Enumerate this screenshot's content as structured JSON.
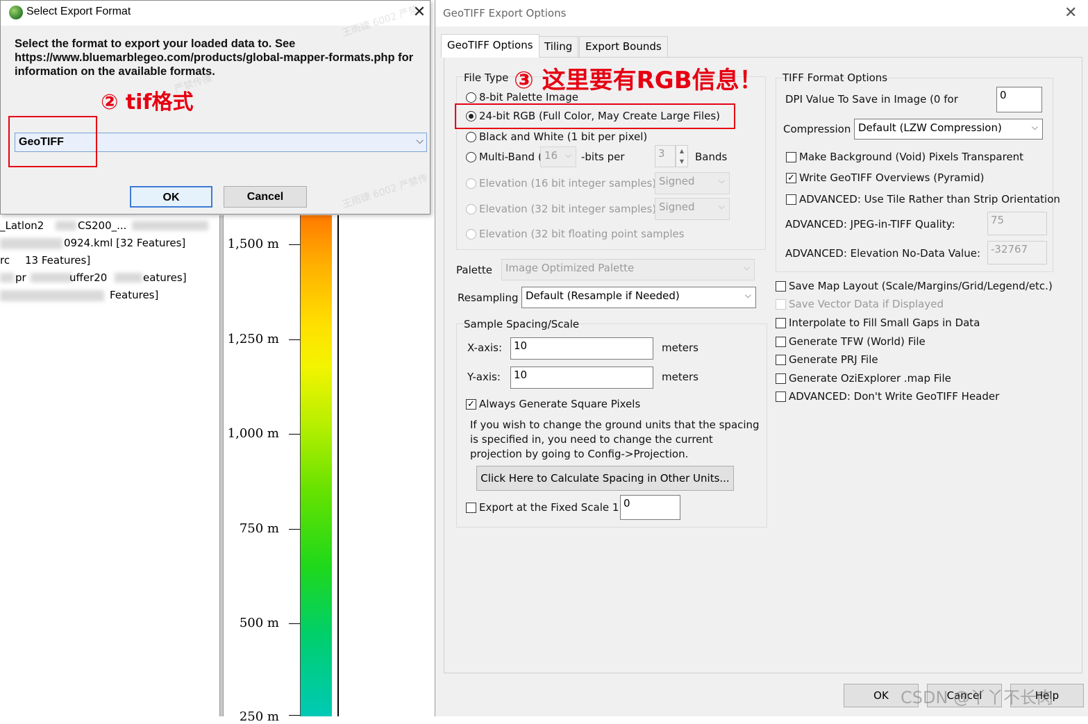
{
  "layers": {
    "row1": "_Latlon2",
    "row1b": "CS200_...",
    "row2": "0924.kml [32 Features]",
    "row3": "rc",
    "row3b": "13 Features]",
    "row4a": "pr",
    "row4b": "uffer20",
    "row4c": "eatures]",
    "row5": "Features]"
  },
  "legend": {
    "ticks": [
      "1,500 m",
      "1,250 m",
      "1,000 m",
      "750 m",
      "500 m",
      "250 m"
    ]
  },
  "export_format_dialog": {
    "title": "Select Export Format",
    "description": "Select the format to export your loaded data to. See https://www.bluemarblegeo.com/products/global-mapper-formats.php for information on the available formats.",
    "selected_format": "GeoTIFF",
    "ok_label": "OK",
    "cancel_label": "Cancel"
  },
  "annotations": {
    "step2": "② tif格式",
    "step3": "③ 这里要有RGB信息！"
  },
  "geotiff_dialog": {
    "title": "GeoTIFF Export Options",
    "tabs": [
      "GeoTIFF Options",
      "Tiling",
      "Export Bounds"
    ],
    "file_type": {
      "label": "File Type",
      "options": [
        "8-bit Palette Image",
        "24-bit RGB (Full Color, May Create Large Files)",
        "Black and White (1 bit per pixel)",
        "Multi-Band (",
        "Elevation (16 bit integer samples)",
        "Elevation (32 bit integer samples)",
        "Elevation (32 bit floating point samples"
      ],
      "bits_value": "16",
      "bits_label": "-bits per",
      "bands_value": "3",
      "bands_label": "Bands",
      "signed_label": "Signed"
    },
    "palette": {
      "label": "Palette",
      "value": "Image Optimized Palette"
    },
    "resampling": {
      "label": "Resampling",
      "value": "Default (Resample if Needed)"
    },
    "spacing": {
      "label": "Sample Spacing/Scale",
      "x_label": "X-axis:",
      "x_value": "10",
      "y_label": "Y-axis:",
      "y_value": "10",
      "unit": "meters",
      "square_pixels": "Always Generate Square Pixels",
      "note": "If you wish to change the ground units that the spacing is specified in, you need to change the current projection by going to Config->Projection.",
      "calc_button": "Click Here to Calculate Spacing in Other Units...",
      "fixed_scale_label": "Export at the Fixed Scale 1:",
      "fixed_scale_value": "0"
    },
    "tiff_options": {
      "label": "TIFF Format Options",
      "dpi_label": "DPI Value To Save in Image (0 for",
      "dpi_value": "0",
      "compression_label": "Compression",
      "compression_value": "Default (LZW Compression)",
      "bg_transparent": "Make Background (Void) Pixels Transparent",
      "overviews": "Write GeoTIFF Overviews (Pyramid)",
      "tile_orientation": "ADVANCED: Use Tile Rather than Strip Orientation",
      "jpeg_label": "ADVANCED: JPEG-in-TIFF Quality:",
      "jpeg_value": "75",
      "nodata_label": "ADVANCED: Elevation No-Data Value:",
      "nodata_value": "-32767"
    },
    "extra_options": [
      "Save Map Layout (Scale/Margins/Grid/Legend/etc.)",
      "Save Vector Data if Displayed",
      "Interpolate to Fill Small Gaps in Data",
      "Generate TFW (World) File",
      "Generate PRJ File",
      "Generate OziExplorer .map File",
      "ADVANCED: Don't Write GeoTIFF Header"
    ],
    "ok_label": "OK",
    "cancel_label": "Cancel",
    "help_label": "Help"
  },
  "watermarks": {
    "csdn": "CSDN @丫丫不长肉",
    "cn_a": "王雨婕 6002 严禁",
    "cn_b": "严禁传播",
    "cn_c": "王雨婕 6002 严禁传"
  },
  "colors": {
    "annotation_red": "#e60012",
    "accent_blue": "#3d7ad6"
  }
}
